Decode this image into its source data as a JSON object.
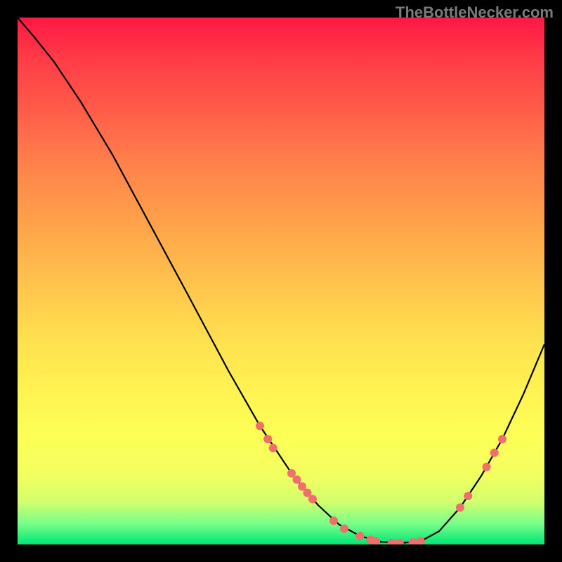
{
  "watermark": "TheBottleNecker.com",
  "chart_data": {
    "type": "line",
    "title": "",
    "xlabel": "",
    "ylabel": "",
    "xlim": [
      0,
      100
    ],
    "ylim": [
      0,
      100
    ],
    "series": [
      {
        "name": "curve",
        "color": "#000000",
        "points": [
          {
            "x": 0.0,
            "y": 100.0
          },
          {
            "x": 3.0,
            "y": 96.5
          },
          {
            "x": 7.0,
            "y": 91.5
          },
          {
            "x": 12.0,
            "y": 84.0
          },
          {
            "x": 18.0,
            "y": 74.0
          },
          {
            "x": 25.0,
            "y": 61.0
          },
          {
            "x": 32.0,
            "y": 48.0
          },
          {
            "x": 40.0,
            "y": 33.0
          },
          {
            "x": 46.0,
            "y": 22.5
          },
          {
            "x": 52.0,
            "y": 13.5
          },
          {
            "x": 57.0,
            "y": 7.5
          },
          {
            "x": 61.0,
            "y": 3.8
          },
          {
            "x": 65.0,
            "y": 1.6
          },
          {
            "x": 69.0,
            "y": 0.5
          },
          {
            "x": 73.0,
            "y": 0.3
          },
          {
            "x": 76.5,
            "y": 0.6
          },
          {
            "x": 80.0,
            "y": 2.5
          },
          {
            "x": 84.0,
            "y": 7.0
          },
          {
            "x": 88.0,
            "y": 13.0
          },
          {
            "x": 92.0,
            "y": 20.0
          },
          {
            "x": 96.0,
            "y": 28.5
          },
          {
            "x": 100.0,
            "y": 38.0
          }
        ]
      }
    ],
    "markers": [
      {
        "x": 46.0,
        "y": 22.5
      },
      {
        "x": 47.5,
        "y": 20.0
      },
      {
        "x": 48.5,
        "y": 18.3
      },
      {
        "x": 52.0,
        "y": 13.5
      },
      {
        "x": 53.0,
        "y": 12.3
      },
      {
        "x": 54.0,
        "y": 11.0
      },
      {
        "x": 55.0,
        "y": 9.8
      },
      {
        "x": 56.0,
        "y": 8.6
      },
      {
        "x": 60.0,
        "y": 4.5
      },
      {
        "x": 62.0,
        "y": 3.0
      },
      {
        "x": 65.0,
        "y": 1.6
      },
      {
        "x": 67.0,
        "y": 0.9
      },
      {
        "x": 68.0,
        "y": 0.6
      },
      {
        "x": 71.0,
        "y": 0.3
      },
      {
        "x": 72.5,
        "y": 0.3
      },
      {
        "x": 75.0,
        "y": 0.4
      },
      {
        "x": 76.5,
        "y": 0.6
      },
      {
        "x": 84.0,
        "y": 7.0
      },
      {
        "x": 85.5,
        "y": 9.2
      },
      {
        "x": 89.0,
        "y": 14.7
      },
      {
        "x": 90.5,
        "y": 17.4
      },
      {
        "x": 92.0,
        "y": 20.0
      }
    ],
    "marker_color": "#ef6f6b",
    "marker_radius": 6
  }
}
